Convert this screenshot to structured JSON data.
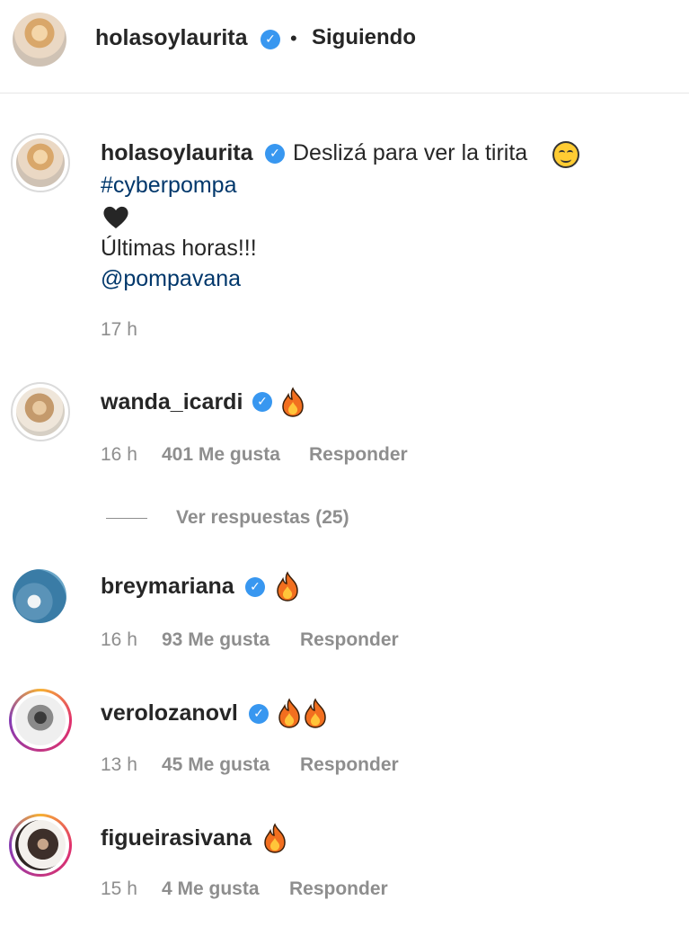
{
  "header": {
    "username": "holasoylaurita",
    "verified_icon": "verified-badge-icon",
    "separator": "•",
    "following_label": "Siguiendo"
  },
  "caption": {
    "username": "holasoylaurita",
    "text": "Deslizá para ver la tirita",
    "emoji": "smiling-face-icon",
    "hashtag": "#cyberpompa",
    "heart": "black-heart-icon",
    "line2": "Últimas horas!!!",
    "mention": "@pompavana",
    "time": "17 h"
  },
  "comments": [
    {
      "username": "wanda_icardi",
      "verified": true,
      "emoji": "🔥",
      "time": "16 h",
      "likes": "401 Me gusta",
      "reply": "Responder"
    },
    {
      "username": "breymariana",
      "verified": true,
      "emoji": "🔥",
      "time": "16 h",
      "likes": "93 Me gusta",
      "reply": "Responder"
    },
    {
      "username": "verolozanovl",
      "verified": true,
      "emoji": "🔥🔥",
      "time": "13 h",
      "likes": "45 Me gusta",
      "reply": "Responder"
    },
    {
      "username": "figueirasivana",
      "verified": false,
      "emoji": "🔥",
      "time": "15 h",
      "likes": "4 Me gusta",
      "reply": "Responder"
    }
  ],
  "view_replies": "Ver respuestas (25)",
  "colors": {
    "verified": "#3897f0",
    "link": "#00376b",
    "meta": "#8e8e8e",
    "text": "#262626"
  }
}
